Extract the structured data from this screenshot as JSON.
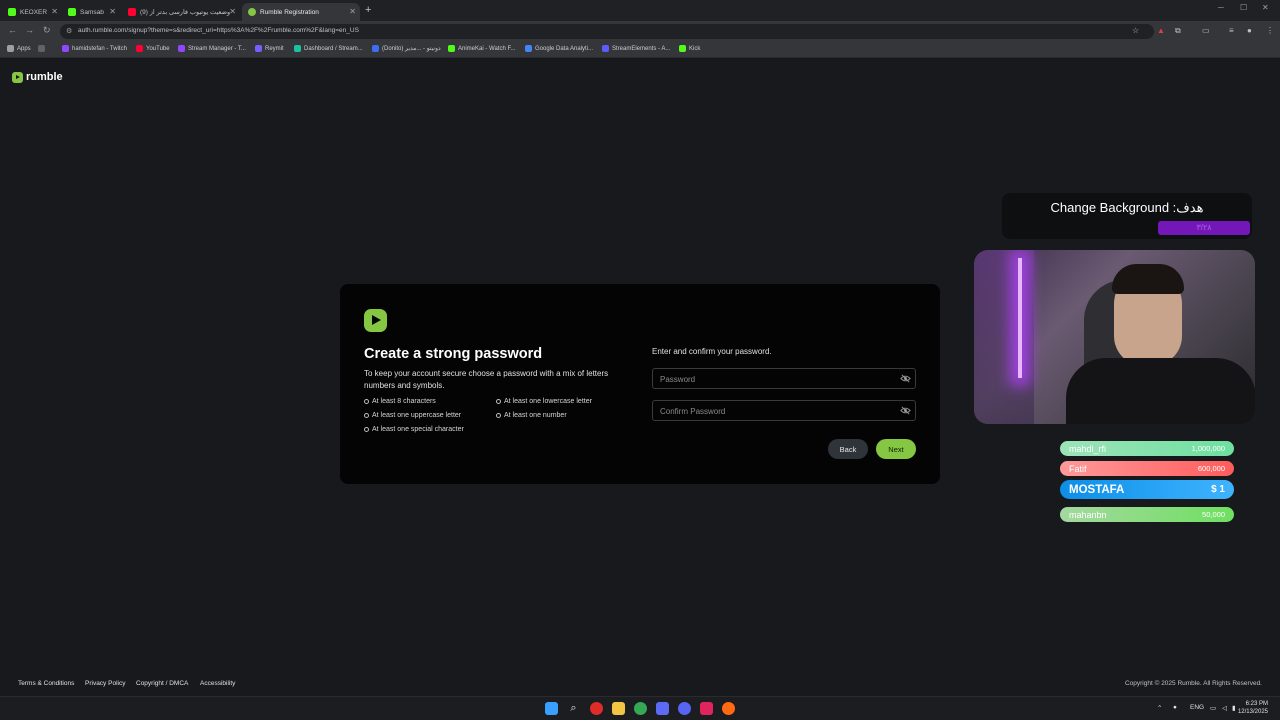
{
  "browser": {
    "tabs": [
      {
        "label": "KEOXER",
        "icon": "kick-favicon",
        "color": "#53fc18"
      },
      {
        "label": "Samsab",
        "icon": "kick-favicon",
        "color": "#53fc18"
      },
      {
        "label": "وضعیت یوتیوب فارسی بدتر از (9)",
        "icon": "youtube-favicon",
        "color": "#ff0033"
      },
      {
        "label": "Rumble Registration",
        "icon": "rumble-favicon",
        "color": "#85c742"
      }
    ],
    "url": "auth.rumble.com/signup?theme=s&redirect_uri=https%3A%2F%2Frumble.com%2F&lang=en_US",
    "bookmarks": [
      {
        "label": "Apps",
        "color": "#9aa0a6"
      },
      {
        "label": "hamidstefan - Twitch",
        "color": "#9146ff"
      },
      {
        "label": "YouTube",
        "color": "#ff0033"
      },
      {
        "label": "Stream Manager - T...",
        "color": "#9146ff"
      },
      {
        "label": "Reymit",
        "color": "#7b5cff"
      },
      {
        "label": "Dashboard / Stream...",
        "color": "#19c3a0"
      },
      {
        "label": "(Donito) دونیتو - ...مدیر",
        "color": "#3b6ef5"
      },
      {
        "label": "AnimeKai - Watch F...",
        "color": "#53fc18"
      },
      {
        "label": "Google Data Analyti...",
        "color": "#4285f4"
      },
      {
        "label": "StreamElements - A...",
        "color": "#5b5bff"
      },
      {
        "label": "Kick",
        "color": "#53fc18"
      }
    ]
  },
  "page": {
    "logo": "rumble",
    "title": "Create a strong password",
    "description": "To keep your account secure choose a password with a mix of letters numbers and symbols.",
    "requirements": [
      "At least 8 characters",
      "At least one lowercase letter",
      "At least one uppercase letter",
      "At least one number",
      "At least one special character"
    ],
    "instruction": "Enter and confirm your password.",
    "password_placeholder": "Password",
    "confirm_placeholder": "Confirm Password",
    "back_label": "Back",
    "next_label": "Next",
    "footer_links": [
      "Terms & Conditions",
      "Privacy Policy",
      "Copyright / DMCA",
      "Accessibility"
    ],
    "copyright": "Copyright © 2025 Rumble. All Rights Reserved.",
    "accent": "#85c742"
  },
  "overlay": {
    "goal_text": "هدف: Change Background",
    "goal_value": "۳/۲۸",
    "leaderboard": [
      {
        "name": "mahdi_rfi",
        "amount": "1,000,000",
        "color": "#6ee0a0"
      },
      {
        "name": "Fatif",
        "amount": "600,000",
        "color": "#ff6b6b"
      },
      {
        "name": "MOSTAFA",
        "amount": "$ 1",
        "color": "#2fa8ff"
      },
      {
        "name": "mahanbn",
        "amount": "50,000",
        "color": "#7be36b"
      }
    ]
  },
  "taskbar": {
    "language": "ENG",
    "time": "6:23 PM",
    "date": "12/13/2025"
  }
}
